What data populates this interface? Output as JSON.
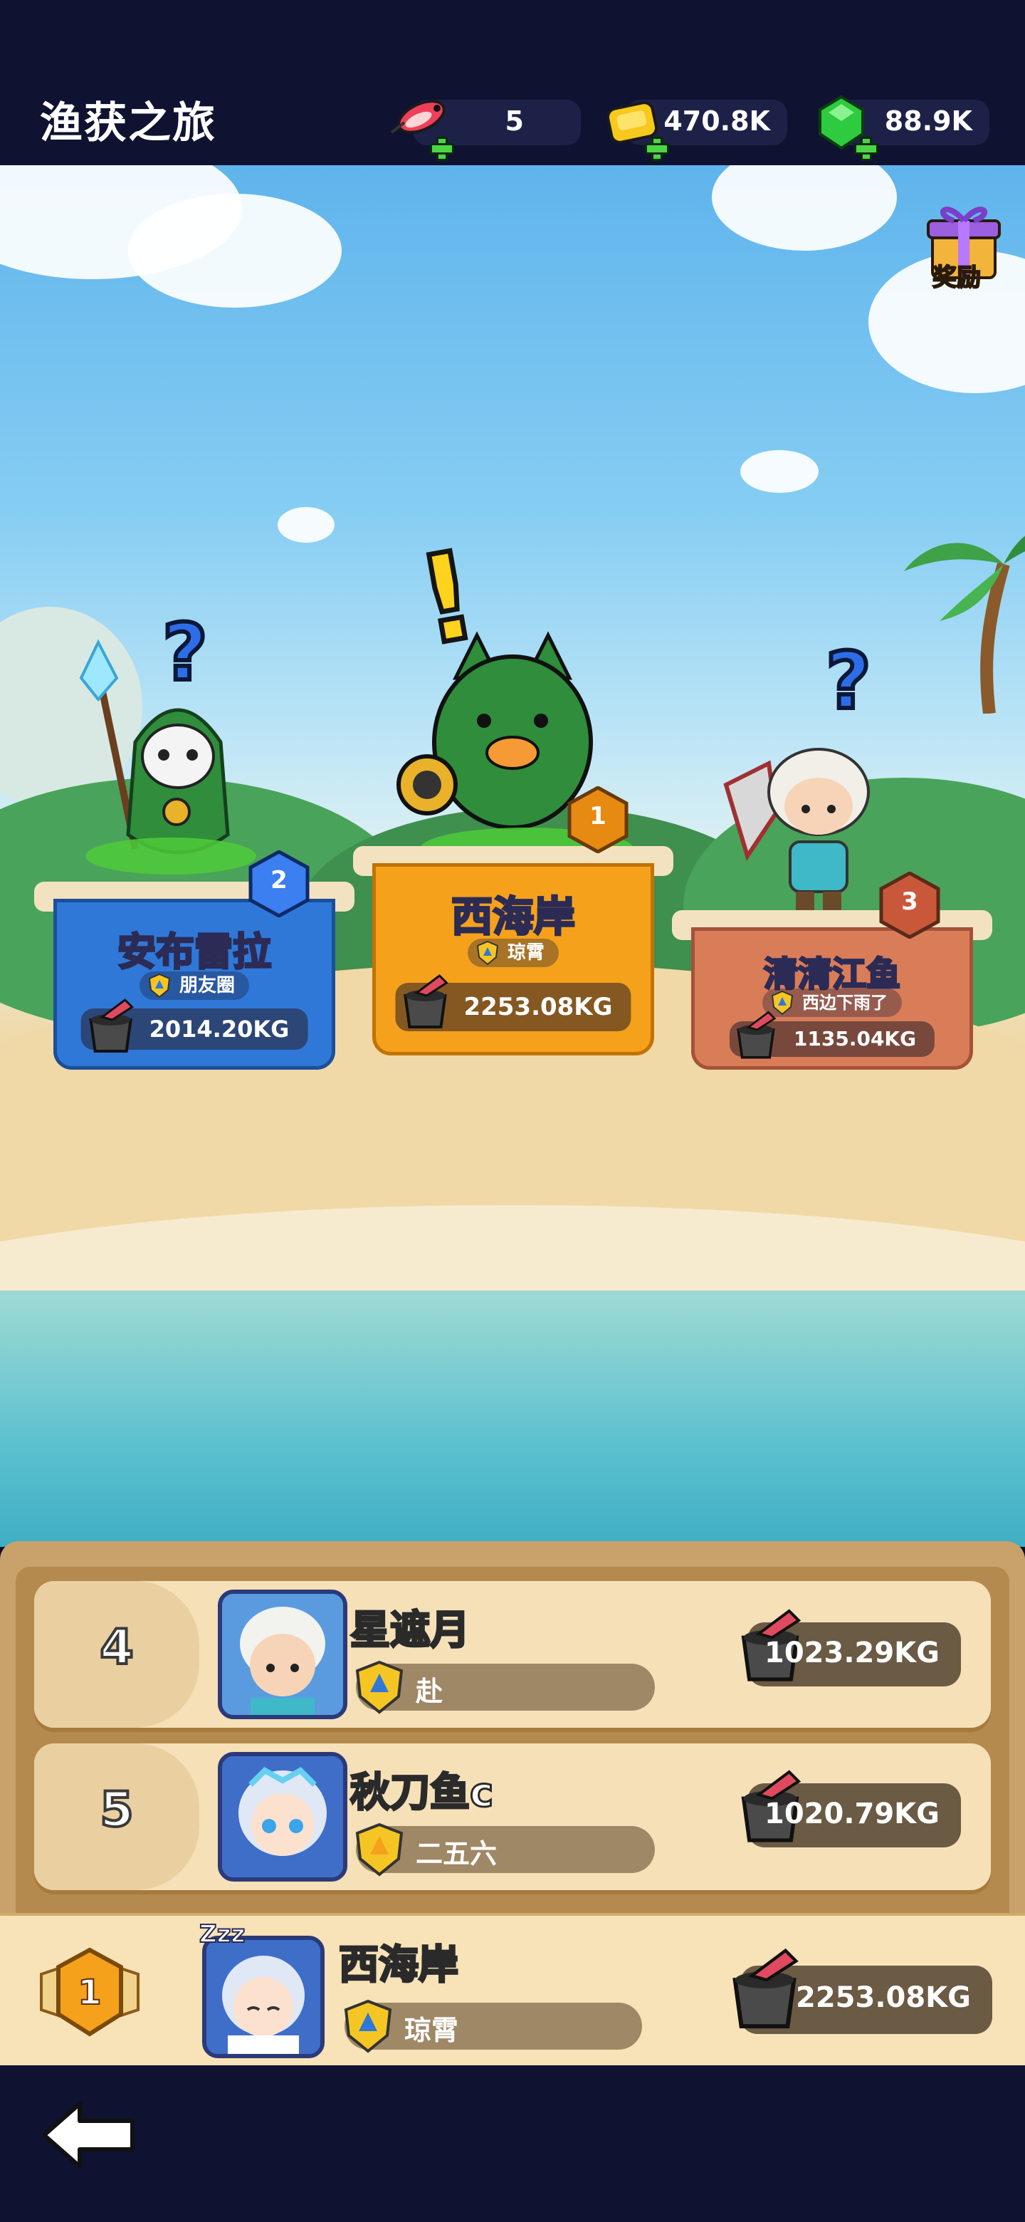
{
  "header": {
    "title": "渔获之旅",
    "resources": {
      "lures": "5",
      "gold": "470.8K",
      "gems": "88.9K"
    }
  },
  "reward": {
    "label": "奖励"
  },
  "podium": [
    {
      "rank": "2",
      "name": "安布雷拉",
      "club": "朋友圈",
      "weight": "2014.20KG",
      "color": "#2f78d8"
    },
    {
      "rank": "1",
      "name": "西海岸",
      "club": "琼霄",
      "weight": "2253.08KG",
      "color": "#f5a11b"
    },
    {
      "rank": "3",
      "name": "清清江鱼",
      "club": "西边下雨了",
      "weight": "1135.04KG",
      "color": "#d97d58"
    }
  ],
  "list": [
    {
      "rank": "4",
      "name": "星遮月",
      "club": "赴",
      "weight": "1023.29KG"
    },
    {
      "rank": "5",
      "name": "秋刀鱼c",
      "club": "二五六",
      "weight": "1020.79KG"
    }
  ],
  "me": {
    "rank": "1",
    "name": "西海岸",
    "club": "琼霄",
    "weight": "2253.08KG",
    "sleep": "Zzz"
  },
  "colors": {
    "gold": "#f5a11b",
    "blue": "#2f78d8",
    "bronze": "#d97d58"
  }
}
